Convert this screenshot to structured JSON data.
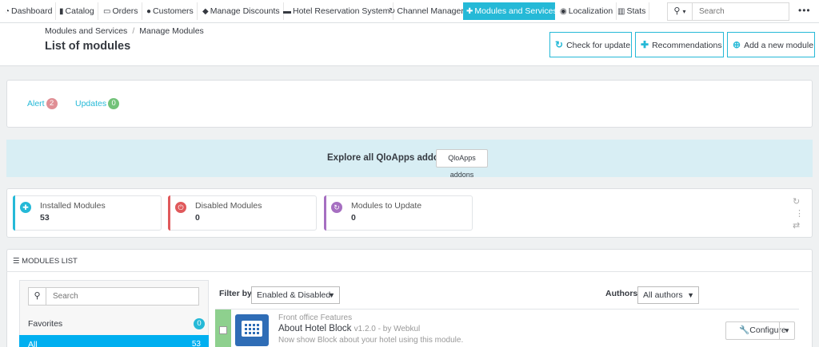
{
  "nav": {
    "items": [
      {
        "label": "Dashboard",
        "icon": "dashboard-icon"
      },
      {
        "label": "Catalog",
        "icon": "book-icon"
      },
      {
        "label": "Orders",
        "icon": "credit-card-icon"
      },
      {
        "label": "Customers",
        "icon": "users-icon"
      },
      {
        "label": "Manage Discounts",
        "icon": "tag-icon"
      },
      {
        "label": "Hotel Reservation System",
        "icon": "bed-icon"
      },
      {
        "label": "Channel Manager",
        "icon": "refresh-icon"
      },
      {
        "label": "Modules and Services",
        "icon": "puzzle-icon",
        "active": true
      },
      {
        "label": "Localization",
        "icon": "globe-icon"
      },
      {
        "label": "Stats",
        "icon": "bar-chart-icon"
      }
    ],
    "search_placeholder": "Search",
    "search_icon": "search-icon",
    "accent_color": "#25b9d7"
  },
  "header": {
    "breadcrumb": [
      "Modules and Services",
      "Manage Modules"
    ],
    "title": "List of modules",
    "buttons": [
      {
        "label": "Check for update",
        "icon": "refresh-icon"
      },
      {
        "label": "Recommendations",
        "icon": "puzzle-icon"
      },
      {
        "label": "Add a new module",
        "icon": "plus-circle-icon"
      }
    ]
  },
  "alerts": {
    "alert_label": "Alert",
    "alert_count": "2",
    "updates_label": "Updates",
    "updates_count": "0"
  },
  "addons": {
    "text": "Explore all QloApps addons",
    "button": "QloApps addons"
  },
  "stats": [
    {
      "label": "Installed Modules",
      "value": "53",
      "color": "#25b9d7",
      "icon": "puzzle-icon"
    },
    {
      "label": "Disabled Modules",
      "value": "0",
      "color": "#e0595b",
      "icon": "power-icon"
    },
    {
      "label": "Modules to Update",
      "value": "0",
      "color": "#a66fc1",
      "icon": "refresh-icon"
    }
  ],
  "modules_list": {
    "title": "MODULES LIST",
    "search_placeholder": "Search",
    "categories": [
      {
        "label": "Favorites",
        "count": "0"
      },
      {
        "label": "All",
        "count": "53",
        "active": true
      }
    ],
    "filter_by_label": "Filter by",
    "filter_value": "Enabled & Disabled",
    "authors_label": "Authors",
    "authors_value": "All authors"
  },
  "module": {
    "category": "Front office Features",
    "name": "About Hotel Block",
    "version": "v1.2.0 - by Webkul",
    "description": "Now show Block about your hotel using this module.",
    "action": "Configure",
    "status_color": "#8ed08e"
  }
}
